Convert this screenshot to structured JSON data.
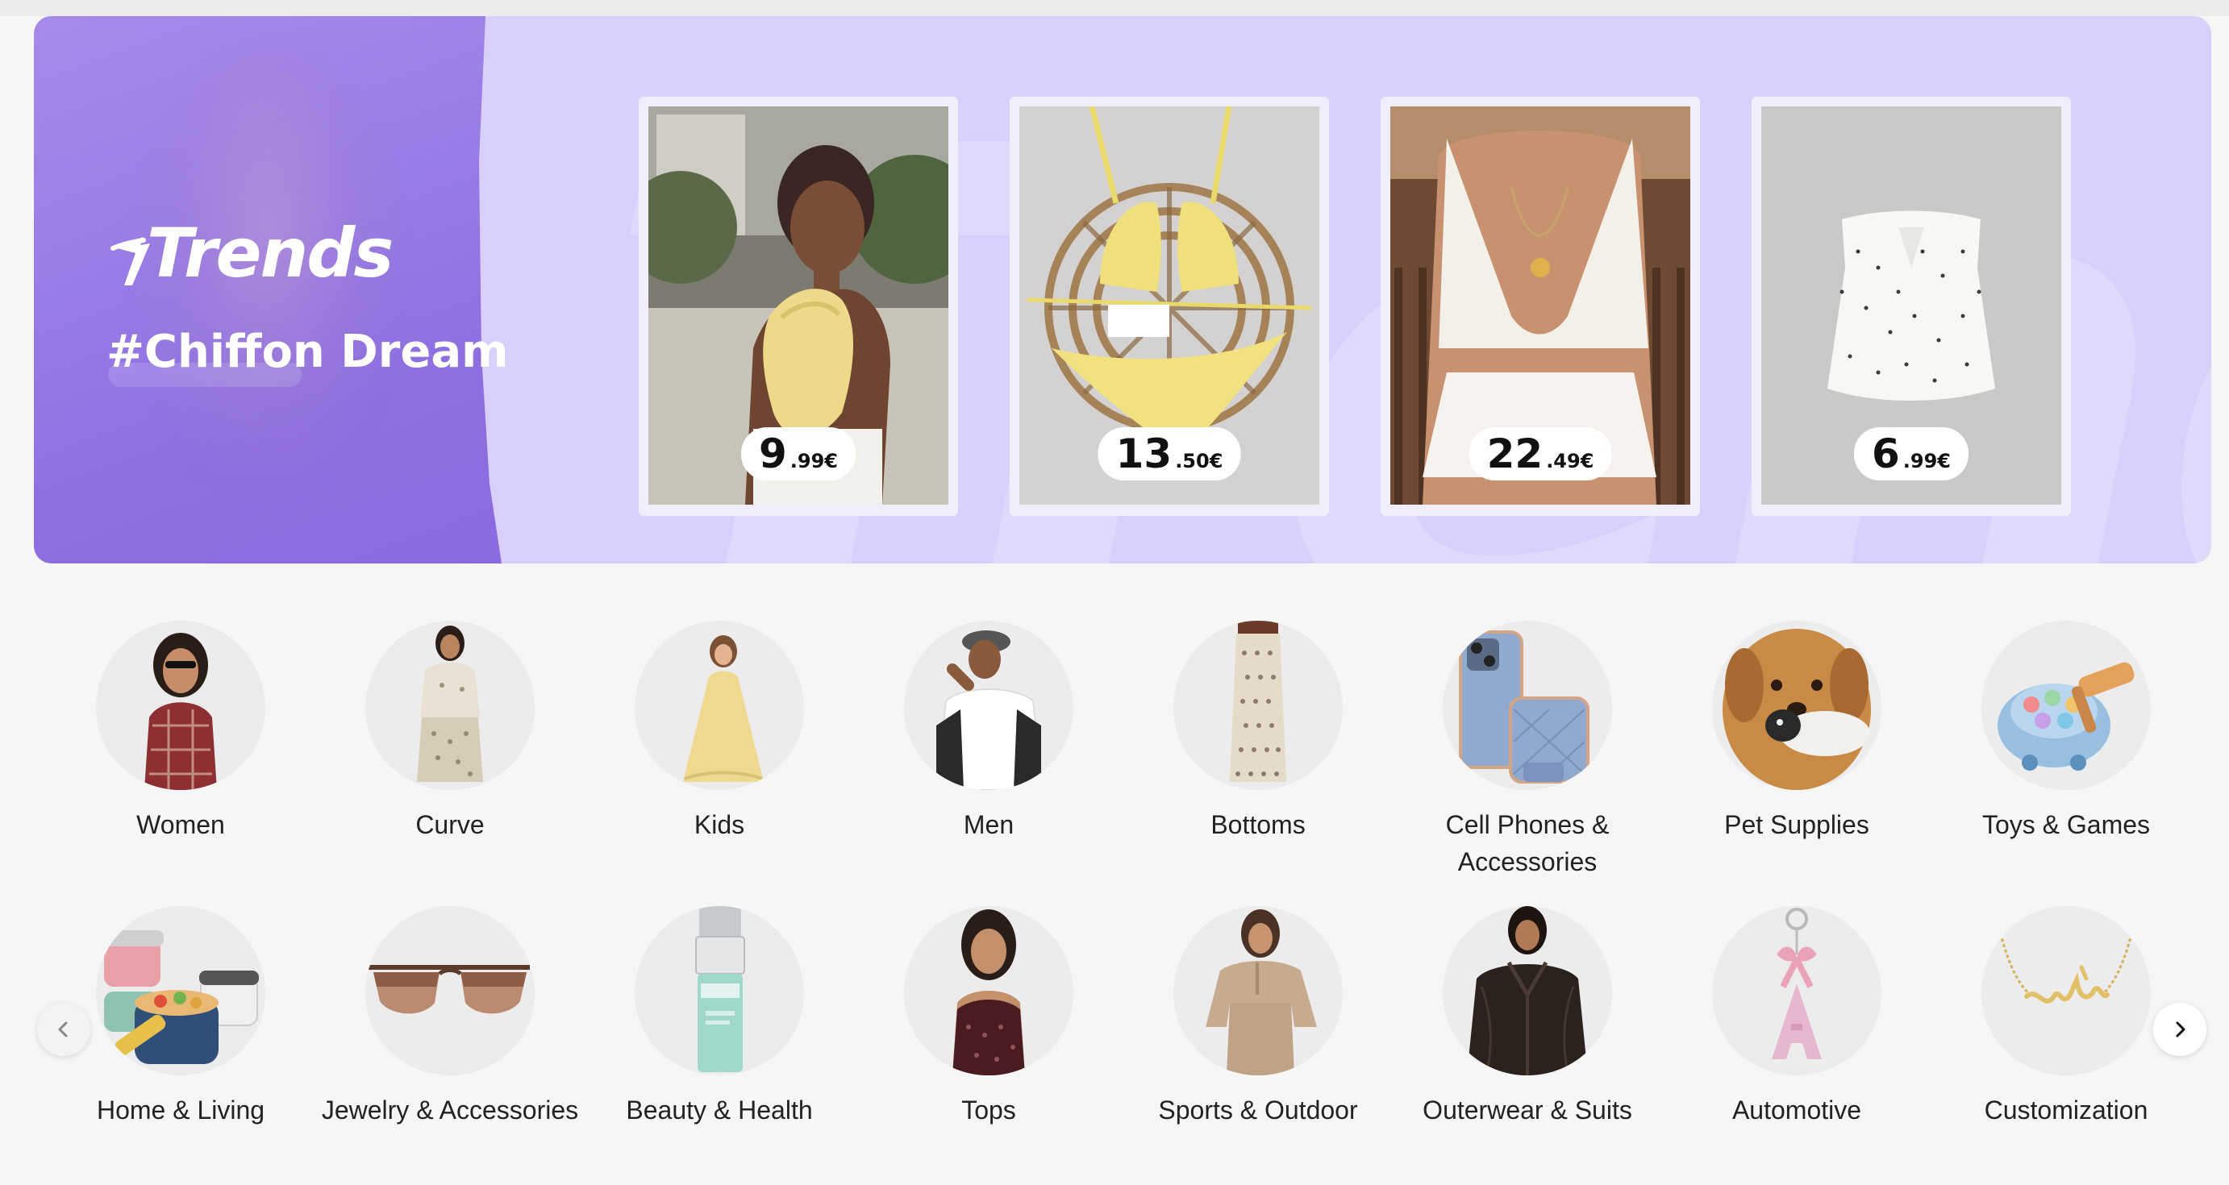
{
  "banner": {
    "logo_text": "Trends",
    "watermark": "Trends",
    "hashtag": "#Chiffon Dream",
    "colors": {
      "panel": "#8e6fe0",
      "background": "#d8cffb",
      "card": "#f1eefc"
    },
    "products": [
      {
        "name": "yellow-halter-top",
        "price_int": "9",
        "price_dec": ".99€"
      },
      {
        "name": "yellow-bikini-set",
        "price_int": "13",
        "price_dec": ".50€"
      },
      {
        "name": "white-lace-crop-set",
        "price_int": "22",
        "price_dec": ".49€"
      },
      {
        "name": "polka-dot-tube-top",
        "price_int": "6",
        "price_dec": ".99€"
      }
    ]
  },
  "categories": {
    "row1": [
      {
        "label": "Women",
        "icon": "women-icon"
      },
      {
        "label": "Curve",
        "icon": "curve-icon"
      },
      {
        "label": "Kids",
        "icon": "kids-icon"
      },
      {
        "label": "Men",
        "icon": "men-icon"
      },
      {
        "label": "Bottoms",
        "icon": "bottoms-icon"
      },
      {
        "label": "Cell Phones & Accessories",
        "icon": "phone-case-icon"
      },
      {
        "label": "Pet Supplies",
        "icon": "dog-icon"
      },
      {
        "label": "Toys & Games",
        "icon": "toy-icon"
      }
    ],
    "row2": [
      {
        "label": "Home & Living",
        "icon": "food-container-icon"
      },
      {
        "label": "Jewelry & Accessories",
        "icon": "sunglasses-icon"
      },
      {
        "label": "Beauty & Health",
        "icon": "serum-bottle-icon"
      },
      {
        "label": "Tops",
        "icon": "tops-icon"
      },
      {
        "label": "Sports & Outdoor",
        "icon": "sweatsuit-icon"
      },
      {
        "label": "Outerwear & Suits",
        "icon": "leather-jacket-icon"
      },
      {
        "label": "Automotive",
        "icon": "letter-keychain-icon"
      },
      {
        "label": "Customization",
        "icon": "name-necklace-icon"
      }
    ]
  },
  "nav": {
    "prev_icon": "chevron-left-icon",
    "next_icon": "chevron-right-icon"
  }
}
